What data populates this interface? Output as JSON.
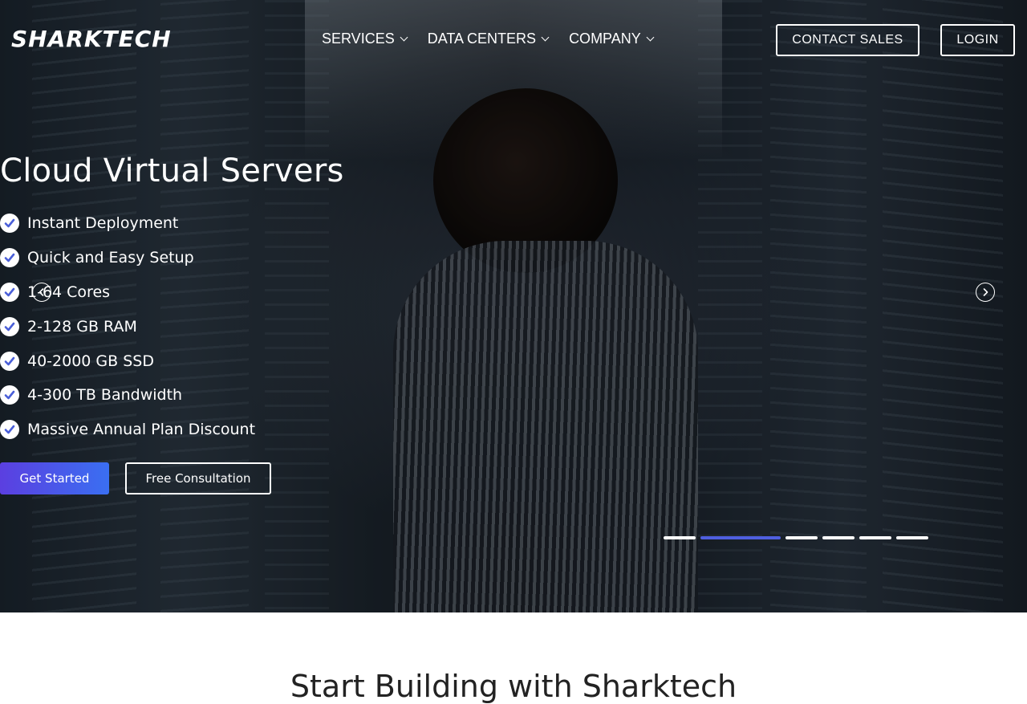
{
  "header": {
    "logo_text": "SHARKTECH",
    "nav": [
      {
        "label": "SERVICES"
      },
      {
        "label": "DATA CENTERS"
      },
      {
        "label": "COMPANY"
      }
    ],
    "contact_sales_label": "CONTACT SALES",
    "login_label": "LOGIN"
  },
  "hero": {
    "title": "Cloud Virtual Servers",
    "features": [
      "Instant Deployment",
      "Quick and Easy Setup",
      "1-64 Cores",
      "2-128 GB RAM",
      "40-2000 GB SSD",
      "4-300 TB Bandwidth",
      "Massive Annual Plan Discount"
    ],
    "primary_cta": "Get Started",
    "secondary_cta": "Free Consultation",
    "slides_total": 6,
    "active_slide": 2
  },
  "section": {
    "title": "Start Building with Sharktech"
  },
  "colors": {
    "accent_gradient_start": "#5b3fe0",
    "accent_gradient_end": "#3a6ff2",
    "check_color": "#4a5fd8",
    "active_dot": "#4f5fe0"
  },
  "icons": {
    "check": "check-circle-icon",
    "prev": "chevron-left-circle-icon",
    "next": "chevron-right-circle-icon",
    "dropdown": "chevron-down-icon"
  }
}
